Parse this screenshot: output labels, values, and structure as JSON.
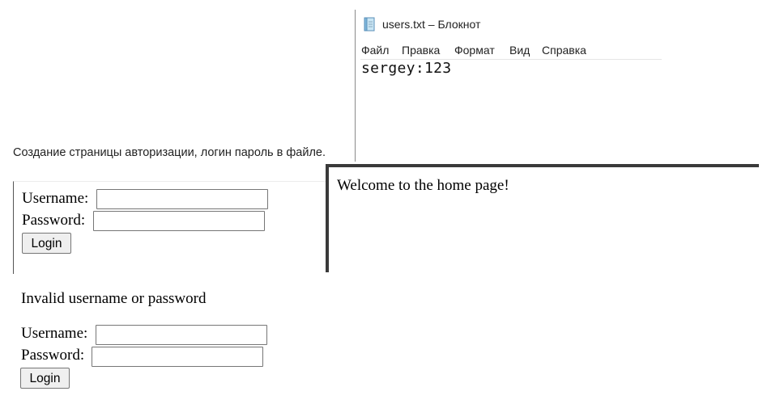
{
  "notepad": {
    "title": "users.txt – Блокнот",
    "menu": [
      "Файл",
      "Правка",
      "Формат",
      "Вид",
      "Справка"
    ],
    "content": "sergey:123"
  },
  "caption": "Создание страницы авторизации, логин пароль в файле.",
  "login_form": {
    "username_label": "Username:",
    "password_label": "Password:",
    "username_value": "",
    "password_value": "",
    "button_label": "Login"
  },
  "home": {
    "welcome": "Welcome to the home page!"
  },
  "error_form": {
    "error_message": "Invalid username or password",
    "username_label": "Username:",
    "password_label": "Password:",
    "username_value": "",
    "password_value": "",
    "button_label": "Login"
  }
}
